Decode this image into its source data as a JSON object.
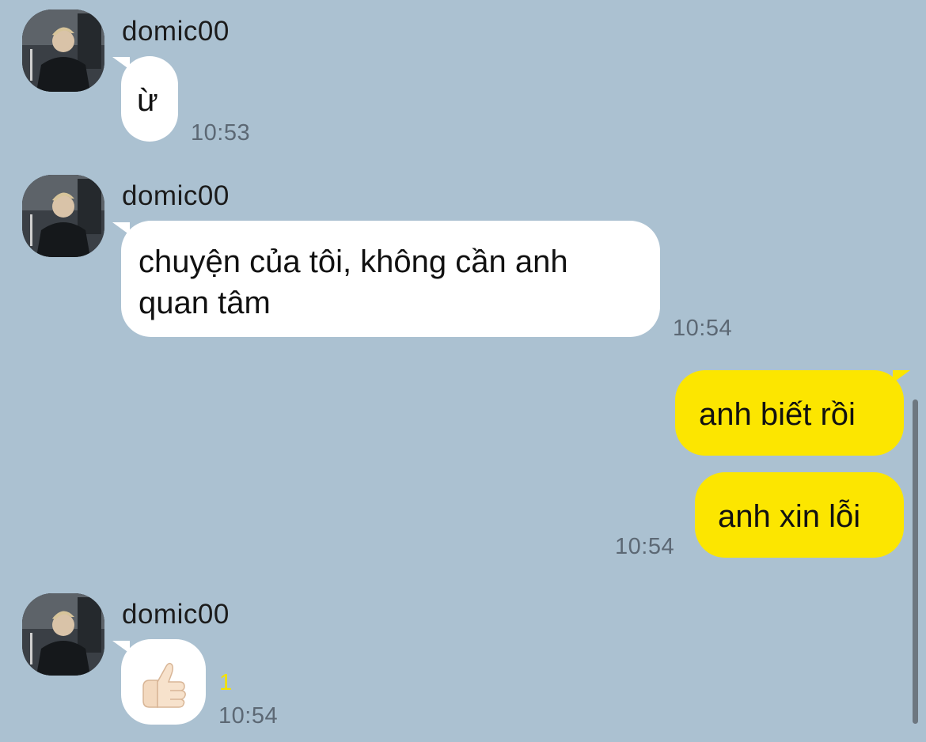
{
  "messages": [
    {
      "sender": "domic00",
      "text": "ừ",
      "time": "10:53"
    },
    {
      "sender": "domic00",
      "text": "chuyện của tôi, không cần anh quan tâm",
      "time": "10:54"
    },
    {
      "text": "anh biết rồi"
    },
    {
      "text": "anh xin lỗi",
      "time": "10:54"
    },
    {
      "sender": "domic00",
      "sticker": "thumbs-up",
      "read_count": "1",
      "time": "10:54"
    }
  ],
  "colors": {
    "background": "#abc1d1",
    "incoming_bubble": "#ffffff",
    "outgoing_bubble": "#fce600",
    "timestamp": "#5c6874",
    "read_count": "#f5e200"
  },
  "icons": {
    "avatar": "profile-photo-icon",
    "sticker": "thumbs-up-icon"
  }
}
